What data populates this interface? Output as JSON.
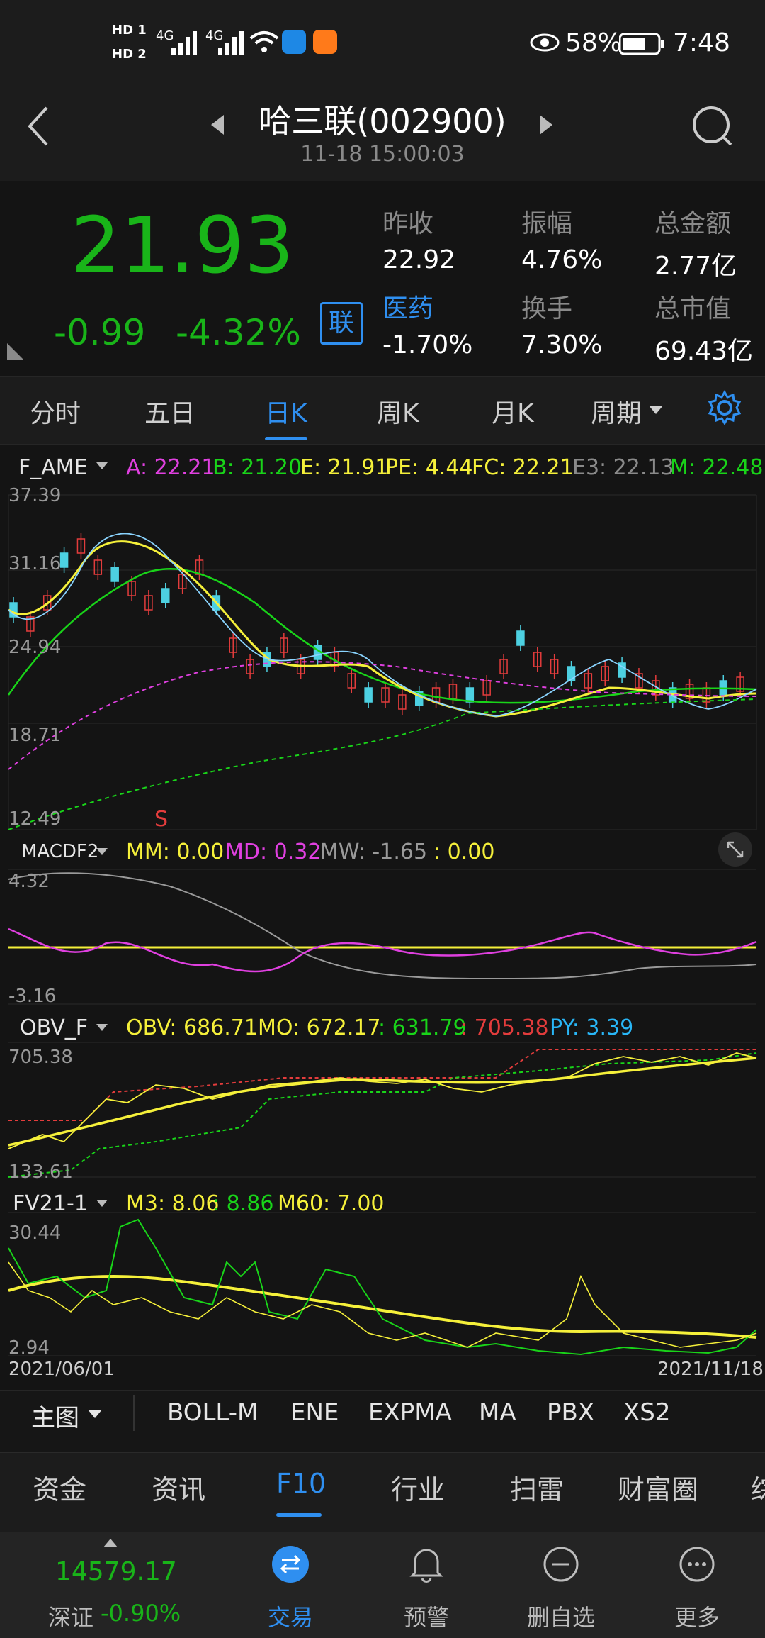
{
  "status": {
    "hd1": "HD 1",
    "hd2": "HD 2",
    "net1": "4G",
    "net2": "4G",
    "battery": "58%",
    "time": "7:48"
  },
  "header": {
    "title": "哈三联(002900)",
    "subtitle": "11-18 15:00:03"
  },
  "quote": {
    "price": "21.93",
    "change": "-0.99",
    "change_pct": "-4.32%",
    "badge": "联",
    "labels": [
      "昨收",
      "振幅",
      "总金额",
      "医药",
      "换手",
      "总市值"
    ],
    "values": [
      "22.92",
      "4.76%",
      "2.77亿",
      "-1.70%",
      "7.30%",
      "69.43亿"
    ]
  },
  "tabs": [
    "分时",
    "五日",
    "日K",
    "周K",
    "月K",
    "周期"
  ],
  "main_chart": {
    "name": "F_AME",
    "A": "A: 22.21",
    "B": "B: 21.20",
    "E": "E: 21.91",
    "PE": "PE: 4.44",
    "FC": "FC: 22.21",
    "E3": "E3: 22.13",
    "M": "M: 22.48",
    "ticks": [
      "37.39",
      "31.16",
      "24.94",
      "18.71",
      "12.49"
    ],
    "marker": "S"
  },
  "macd": {
    "name": "MACDF2",
    "MM": "MM: 0.00",
    "MD": "MD: 0.32",
    "MW": "MW: -1.65",
    "Z": ": 0.00",
    "ticks": [
      "4.32",
      "-3.16"
    ]
  },
  "obv": {
    "name": "OBV_F",
    "OBV": "OBV: 686.71",
    "MO": "MO: 672.17",
    "G": ": 631.79",
    "R": ": 705.38",
    "PY": "PY: 3.39",
    "ticks": [
      "705.38",
      "133.61"
    ]
  },
  "fv": {
    "name": "FV21-1",
    "M3": "M3: 8.06",
    "G": ": 8.86",
    "M60": "M60: 7.00",
    "ticks": [
      "30.44",
      "2.94"
    ],
    "date_start": "2021/06/01",
    "date_end": "2021/11/18"
  },
  "indicators": {
    "main": "主图",
    "items": [
      "BOLL-M",
      "ENE",
      "EXPMA",
      "MA",
      "PBX",
      "XS2"
    ]
  },
  "bottom_tabs": [
    "资金",
    "资讯",
    "F10",
    "行业",
    "扫雷",
    "财富圈",
    "综"
  ],
  "bottom_nav": {
    "index_value": "14579.17",
    "index_name": "深证",
    "index_change": "-0.90%",
    "items": [
      "交易",
      "预警",
      "删自选",
      "更多"
    ]
  },
  "colors": {
    "accent": "#2f8ff0",
    "up": "#e33c3c",
    "down": "#19b419",
    "yellow": "#f5f03a",
    "magenta": "#e040e0",
    "gray": "#8a8a8a"
  }
}
